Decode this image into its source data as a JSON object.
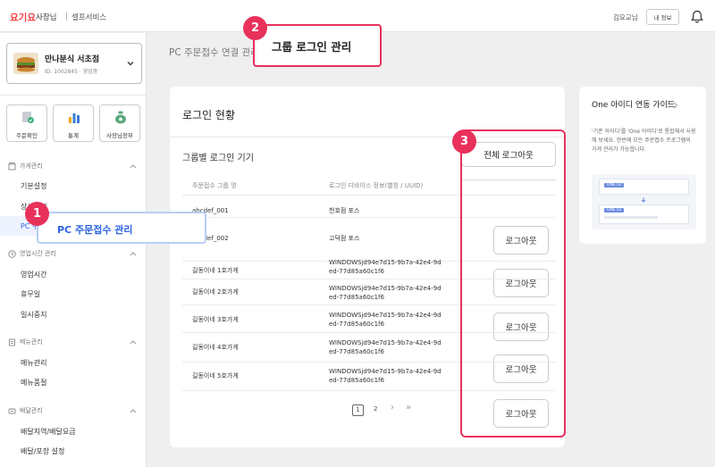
{
  "header": {
    "brand": "요기요",
    "owner_label": "사장님",
    "self_service": "셀프서비스",
    "user_name": "김요교님",
    "my_info_label": "내 정보"
  },
  "sidebar": {
    "store_name": "만나분식 서초점",
    "store_sub": "ID. 1002845 · 영업중",
    "quick_links": [
      "주문확인",
      "통계",
      "사장님장부"
    ],
    "sections": [
      {
        "label": "가게관리",
        "items": [
          "기본설정",
          "상세설정",
          "PC 주문접수 관리"
        ]
      },
      {
        "label": "영업시간 관리",
        "items": [
          "영업시간",
          "휴무일",
          "일시중지"
        ]
      },
      {
        "label": "메뉴관리",
        "items": [
          "메뉴관리",
          "메뉴품절"
        ]
      },
      {
        "label": "배달관리",
        "items": [
          "배달지역/배달요금",
          "배달/포장 설정"
        ]
      }
    ]
  },
  "main": {
    "page_title": "PC 주문접수 연결 관리",
    "panel_title": "로그인 현황",
    "section_title": "그룹별 로그인 기기",
    "all_logout_label": "전체 로그아웃",
    "columns": [
      "주문접수 그룹 명",
      "로그인 디바이스 정보(별칭 / UUID)"
    ],
    "rows": [
      {
        "group": "abcdef_001",
        "device": [
          "천호점 포스"
        ],
        "has_button": false
      },
      {
        "group": "abcdef_002",
        "device": [
          "고덕점 포스"
        ],
        "has_button": true
      },
      {
        "group": "길동이네 1호가게",
        "device": [
          "WINDOWSjd94e7d15-9b7a-42e4-9d",
          "ed-77d85a60c1f6"
        ],
        "has_button": true
      },
      {
        "group": "길동이네 2호가게",
        "device": [
          "WINDOWSjd94e7d15-9b7a-42e4-9d",
          "ed-77d85a60c1f6"
        ],
        "has_button": true
      },
      {
        "group": "길동이네 3호가게",
        "device": [
          "WINDOWSjd94e7d15-9b7a-42e4-9d",
          "ed-77d85a60c1f6"
        ],
        "has_button": true
      },
      {
        "group": "길동이네 4호가게",
        "device": [
          "WINDOWSjd94e7d15-9b7a-42e4-9d",
          "ed-77d85a60c1f6"
        ],
        "has_button": true
      },
      {
        "group": "길동이네 5호가게",
        "device": [
          "WINDOWSjd94e7d15-9b7a-42e4-9d",
          "ed-77d85a60c1f6"
        ],
        "has_button": true
      }
    ],
    "logout_label": "로그아웃",
    "pages": [
      "1",
      "2"
    ],
    "next_label": "›",
    "last_label": "»"
  },
  "guide": {
    "title": "One 아이디 연동 가이드",
    "desc": "'기존 아이디'를 'One 아이디'로 통합해서 사용해 보세요. 한번에 모든 주문접수 프로그램의 가게 관리가 가능합니다.",
    "illust_tag_a": "ONE ID",
    "illust_tag_b": "ONE ID"
  },
  "annotations": {
    "markers": [
      "1",
      "2",
      "3"
    ],
    "callout_1": "PC 주문접수 관리",
    "callout_2": "그룹 로그인 관리"
  },
  "colors": {
    "brand": "#f5393c",
    "accent": "#e8315b",
    "link": "#2b63e0"
  }
}
